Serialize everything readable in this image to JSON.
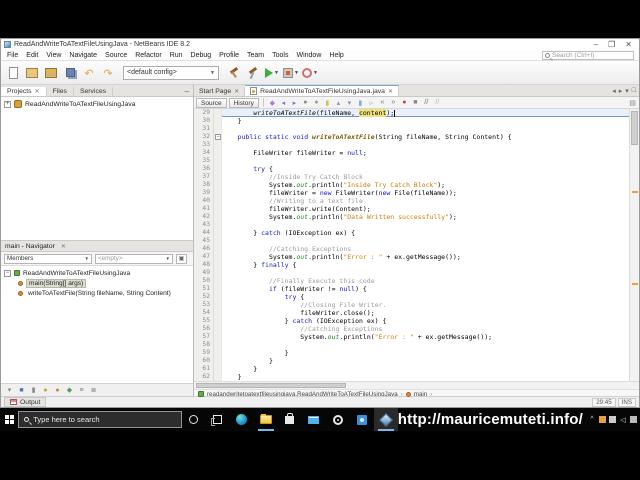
{
  "colors": {
    "keyword": "#1117c4",
    "string": "#ce7b00",
    "comment": "#9b9b9b",
    "method_decl": "#7a5c00",
    "static_field": "#1c881c",
    "occurrence_highlight": "#efe17c",
    "current_line": "#e9f0fb",
    "taskbar_accent": "#76b9ed"
  },
  "window": {
    "title": "ReadAndWriteToATextFileUsingJava - NetBeans IDE 8.2",
    "controls": {
      "minimize": "–",
      "maximize": "❐",
      "close": "✕"
    },
    "menu": [
      "File",
      "Edit",
      "View",
      "Navigate",
      "Source",
      "Refactor",
      "Run",
      "Debug",
      "Profile",
      "Team",
      "Tools",
      "Window",
      "Help"
    ],
    "quick_search_placeholder": "Search (Ctrl+I)",
    "toolbar": {
      "config_value": "<default config>",
      "icons_left": [
        {
          "name": "new-file-icon"
        },
        {
          "name": "new-project-icon"
        },
        {
          "name": "open-project-icon"
        },
        {
          "name": "save-all-icon"
        },
        {
          "name": "undo-icon"
        },
        {
          "name": "redo-icon"
        }
      ],
      "icons_right": [
        {
          "name": "build-project-icon"
        },
        {
          "name": "clean-build-icon"
        },
        {
          "name": "run-project-icon",
          "caret": true
        },
        {
          "name": "debug-project-icon",
          "caret": true
        },
        {
          "name": "profile-project-icon",
          "caret": true
        }
      ]
    }
  },
  "projects_panel": {
    "tabs": [
      {
        "label": "Projects",
        "active": true,
        "closable": true
      },
      {
        "label": "Files",
        "active": false
      },
      {
        "label": "Services",
        "active": false
      }
    ],
    "minimize_glyph": "–",
    "tree": [
      {
        "label": "ReadAndWriteToATextFileUsingJava",
        "icon": "java-project-icon",
        "expander": "+"
      }
    ]
  },
  "navigator": {
    "title": "main - Navigator",
    "close_glyph": "✕",
    "members_filter_value": "Members",
    "secondary_filter_value": "<empty>",
    "class_row": {
      "label": "ReadAndWriteToATextFileUsingJava",
      "icon": "class-icon",
      "expander": "−"
    },
    "members": [
      {
        "label": "main(String[] args)",
        "icon": "method-icon",
        "selected": true
      },
      {
        "label": "writeToATextFile(String fileName, String Content)",
        "icon": "method-icon",
        "selected": false
      }
    ],
    "filter_icons": [
      {
        "name": "show-inherited-icon",
        "glyph": "▾",
        "color": "#8a8a5a"
      },
      {
        "name": "show-fields-icon",
        "glyph": "■",
        "color": "#4f78b0"
      },
      {
        "name": "show-static-members-icon",
        "glyph": "▮",
        "color": "#888888"
      },
      {
        "name": "show-constructors-icon",
        "glyph": "●",
        "color": "#c9a227"
      },
      {
        "name": "show-methods-icon",
        "glyph": "●",
        "color": "#d0852a"
      },
      {
        "name": "show-public-only-icon",
        "glyph": "◆",
        "color": "#5a9a5a"
      },
      {
        "name": "sort-alpha-icon",
        "glyph": "≡",
        "color": "#777777"
      },
      {
        "name": "sort-source-icon",
        "glyph": "≣",
        "color": "#777777"
      }
    ]
  },
  "output_bar": {
    "label": "Output"
  },
  "status": {
    "caret_position": "29:45",
    "insert_mode": "INS"
  },
  "editor": {
    "tabs": [
      {
        "label": "Start Page",
        "active": false,
        "icon": null
      },
      {
        "label": "ReadAndWriteToATextFileUsingJava.java",
        "active": true,
        "icon": "java-file-icon"
      }
    ],
    "corner_icons": [
      {
        "name": "scroll-tabs-left-icon",
        "glyph": "◂"
      },
      {
        "name": "scroll-tabs-right-icon",
        "glyph": "▸"
      },
      {
        "name": "tab-list-icon",
        "glyph": "▾"
      },
      {
        "name": "maximize-editor-icon",
        "glyph": "□"
      }
    ],
    "source_button": "Source",
    "history_button": "History",
    "toolbar_icons": [
      {
        "name": "last-edit-icon",
        "glyph": "◆",
        "color": "#b07ad6"
      },
      {
        "name": "back-icon",
        "glyph": "◂",
        "color": "#6b79c9"
      },
      {
        "name": "forward-icon",
        "glyph": "▸",
        "color": "#6b79c9"
      },
      {
        "name": "find-selection-icon",
        "glyph": "●",
        "color": "#8a8a8a"
      },
      {
        "name": "find-occurrences-icon",
        "glyph": "●",
        "color": "#9a9a9a"
      },
      {
        "name": "toggle-highlight-icon",
        "glyph": "▮",
        "color": "#d6c44a"
      },
      {
        "name": "previous-occurrence-icon",
        "glyph": "▴",
        "color": "#7f8fbb"
      },
      {
        "name": "next-occurrence-icon",
        "glyph": "▾",
        "color": "#7f8fbb"
      },
      {
        "name": "toggle-bookmark-icon",
        "glyph": "▮",
        "color": "#7fb0d8"
      },
      {
        "name": "next-bookmark-icon",
        "glyph": "▹",
        "color": "#7fb0d8"
      },
      {
        "name": "shift-left-icon",
        "glyph": "«",
        "color": "#777777"
      },
      {
        "name": "shift-right-icon",
        "glyph": "»",
        "color": "#777777"
      },
      {
        "name": "start-macro-icon",
        "glyph": "●",
        "color": "#c04444"
      },
      {
        "name": "stop-macro-icon",
        "glyph": "■",
        "color": "#888888"
      },
      {
        "name": "comment-icon",
        "glyph": "//",
        "color": "#6a6a6a"
      },
      {
        "name": "uncomment-icon",
        "glyph": "//",
        "color": "#b5b5b5"
      }
    ],
    "breadcrumb": [
      {
        "label": "readandwritetoatextfileusingjava.ReadAndWriteToATextFileUsingJava",
        "icon": "class-icon"
      },
      {
        "label": "main",
        "icon": "method-icon"
      }
    ],
    "code": {
      "lines": [
        {
          "n": 29,
          "cur": true,
          "caret": true,
          "seg": [
            [
              "p",
              "        "
            ],
            [
              "i",
              "writeToATextFile"
            ],
            [
              "p",
              "(fileName, "
            ],
            [
              "hl",
              "content"
            ],
            [
              "p",
              ");"
            ]
          ]
        },
        {
          "n": 30,
          "seg": [
            [
              "p",
              "    }"
            ]
          ]
        },
        {
          "n": 31,
          "seg": []
        },
        {
          "n": 32,
          "fold": "−",
          "seg": [
            [
              "p",
              "    "
            ],
            [
              "k",
              "public"
            ],
            [
              "p",
              " "
            ],
            [
              "k",
              "static"
            ],
            [
              "p",
              " "
            ],
            [
              "k",
              "void"
            ],
            [
              "p",
              " "
            ],
            [
              "m",
              "writeToATextFile"
            ],
            [
              "p",
              "(String fileName, String Content) {"
            ]
          ]
        },
        {
          "n": 33,
          "seg": []
        },
        {
          "n": 34,
          "seg": [
            [
              "p",
              "        FileWriter fileWriter = "
            ],
            [
              "k",
              "null"
            ],
            [
              "p",
              ";"
            ]
          ]
        },
        {
          "n": 35,
          "seg": []
        },
        {
          "n": 36,
          "seg": [
            [
              "p",
              "        "
            ],
            [
              "k",
              "try"
            ],
            [
              "p",
              " {"
            ]
          ]
        },
        {
          "n": 37,
          "seg": [
            [
              "c",
              "            //Inside Try Catch Block"
            ]
          ]
        },
        {
          "n": 38,
          "seg": [
            [
              "p",
              "            System."
            ],
            [
              "f",
              "out"
            ],
            [
              "p",
              ".println("
            ],
            [
              "s",
              "\"Inside Try Catch Block\""
            ],
            [
              "p",
              ");"
            ]
          ]
        },
        {
          "n": 39,
          "seg": [
            [
              "p",
              "            fileWriter = "
            ],
            [
              "k",
              "new"
            ],
            [
              "p",
              " FileWriter("
            ],
            [
              "k",
              "new"
            ],
            [
              "p",
              " File(fileName));"
            ]
          ]
        },
        {
          "n": 40,
          "seg": [
            [
              "c",
              "            //Writing to a text file"
            ]
          ]
        },
        {
          "n": 41,
          "seg": [
            [
              "p",
              "            fileWriter.write(Content);"
            ]
          ]
        },
        {
          "n": 42,
          "seg": [
            [
              "p",
              "            System."
            ],
            [
              "f",
              "out"
            ],
            [
              "p",
              ".println("
            ],
            [
              "s",
              "\"Data Written successfully\""
            ],
            [
              "p",
              ");"
            ]
          ]
        },
        {
          "n": 43,
          "seg": []
        },
        {
          "n": 44,
          "seg": [
            [
              "p",
              "        } "
            ],
            [
              "k",
              "catch"
            ],
            [
              "p",
              " (IOException ex) {"
            ]
          ]
        },
        {
          "n": 45,
          "seg": []
        },
        {
          "n": 46,
          "seg": [
            [
              "c",
              "            //Catching Exceptions"
            ]
          ]
        },
        {
          "n": 47,
          "seg": [
            [
              "p",
              "            System."
            ],
            [
              "f",
              "out"
            ],
            [
              "p",
              ".println("
            ],
            [
              "s",
              "\"Error : \""
            ],
            [
              "p",
              " + ex.getMessage());"
            ]
          ]
        },
        {
          "n": 48,
          "seg": [
            [
              "p",
              "        } "
            ],
            [
              "k",
              "finally"
            ],
            [
              "p",
              " {"
            ]
          ]
        },
        {
          "n": 49,
          "seg": []
        },
        {
          "n": 50,
          "seg": [
            [
              "c",
              "            //Finally Execute this code"
            ]
          ]
        },
        {
          "n": 51,
          "seg": [
            [
              "p",
              "            "
            ],
            [
              "k",
              "if"
            ],
            [
              "p",
              " (fileWriter != "
            ],
            [
              "k",
              "null"
            ],
            [
              "p",
              ") {"
            ]
          ]
        },
        {
          "n": 52,
          "seg": [
            [
              "p",
              "                "
            ],
            [
              "k",
              "try"
            ],
            [
              "p",
              " {"
            ]
          ]
        },
        {
          "n": 53,
          "seg": [
            [
              "c",
              "                    //Closing File Writer."
            ]
          ]
        },
        {
          "n": 54,
          "seg": [
            [
              "p",
              "                    fileWriter.close();"
            ]
          ]
        },
        {
          "n": 55,
          "seg": [
            [
              "p",
              "                } "
            ],
            [
              "k",
              "catch"
            ],
            [
              "p",
              " (IOException ex) {"
            ]
          ]
        },
        {
          "n": 56,
          "seg": [
            [
              "c",
              "                    //Catching Exceptions"
            ]
          ]
        },
        {
          "n": 57,
          "seg": [
            [
              "p",
              "                    System."
            ],
            [
              "f",
              "out"
            ],
            [
              "p",
              ".println("
            ],
            [
              "s",
              "\"Error : \""
            ],
            [
              "p",
              " + ex.getMessage());"
            ]
          ]
        },
        {
          "n": 58,
          "seg": []
        },
        {
          "n": 59,
          "seg": [
            [
              "p",
              "                }"
            ]
          ]
        },
        {
          "n": 60,
          "seg": [
            [
              "p",
              "            }"
            ]
          ]
        },
        {
          "n": 61,
          "seg": [
            [
              "p",
              "        }"
            ]
          ]
        },
        {
          "n": 62,
          "seg": [
            [
              "p",
              "    }"
            ]
          ]
        }
      ]
    }
  },
  "taskbar": {
    "search_placeholder": "Type here to search",
    "app_icons": [
      {
        "name": "cortana-icon"
      },
      {
        "name": "task-view-icon"
      },
      {
        "name": "edge-icon"
      },
      {
        "name": "file-explorer-icon",
        "active": true
      },
      {
        "name": "store-icon"
      },
      {
        "name": "mail-icon"
      },
      {
        "name": "settings-icon"
      },
      {
        "name": "photos-icon"
      },
      {
        "name": "netbeans-icon",
        "active": true,
        "highlighted": true
      }
    ],
    "watermark": "http://mauricemuteti.info/",
    "tray_icons": [
      {
        "name": "tray-hidden-icons-chevron",
        "glyph": "^",
        "color": "#dddddd"
      },
      {
        "name": "tray-app-icon",
        "glyph": "",
        "color": "#e8a33d"
      },
      {
        "name": "tray-keyboard-icon",
        "glyph": "",
        "color": "#cccccc"
      },
      {
        "name": "tray-volume-icon",
        "glyph": "◁",
        "color": "#dddddd"
      },
      {
        "name": "tray-network-icon",
        "glyph": "",
        "color": "#bbbbbb"
      }
    ]
  }
}
